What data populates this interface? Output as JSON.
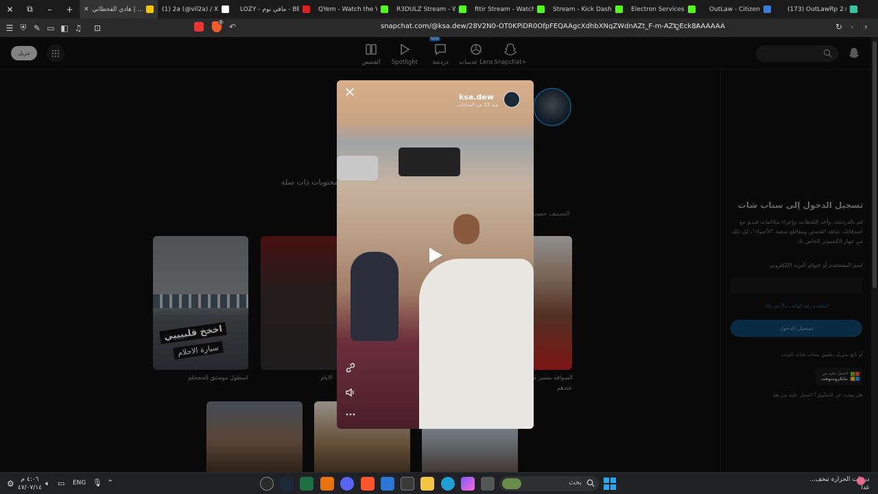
{
  "browser": {
    "tabs": [
      {
        "title": "هادي القحطاني | ...",
        "fav_color": "#f5c400",
        "active": true
      },
      {
        "title": "(1) 2a (@vil2a) / X",
        "fav_color": "#ffffff",
        "active": false
      },
      {
        "title": "LOZY - مافي نوم - BE...",
        "fav_color": "#e02020",
        "active": false
      },
      {
        "title": "QYem - Watch the VOD",
        "fav_color": "#53fc18",
        "active": false
      },
      {
        "title": "R3DULZ Stream - Watc...",
        "fav_color": "#53fc18",
        "active": false
      },
      {
        "title": "fttir Stream - Watch Li...",
        "fav_color": "#53fc18",
        "active": false
      },
      {
        "title": "Stream - Kick Dash...",
        "fav_color": "#53fc18",
        "active": false
      },
      {
        "title": "Electron Services",
        "fav_color": "#53fc18",
        "active": false
      },
      {
        "title": "OutLaw - Citizen",
        "fav_color": "#3a7bd5",
        "active": false
      },
      {
        "title": "(173) OutLawRp 2.0 - L...",
        "fav_color": "#37c4a0",
        "active": false
      }
    ],
    "url": "snapchat.com/@ksa.dew/28V2N0-OT0KPiDR0OfpFEQAAgcXdhbXNqZWdnAZt_F-m-AZt_Eck8AAAAAA",
    "shield_badge": "2"
  },
  "snap_nav": {
    "items": [
      {
        "label": "القصص",
        "icon": "stories-icon"
      },
      {
        "label": "Spotlight",
        "icon": "spotlight-play-icon"
      },
      {
        "label": "دردشة",
        "icon": "chat-icon",
        "badge": "NEW"
      },
      {
        "label": "عدسات Lens",
        "icon": "lens-icon"
      },
      {
        "label": "Snapchat+",
        "icon": "snapchat-plus-icon"
      }
    ],
    "download_label": "تنزيل"
  },
  "login": {
    "title": "تسجيل الدخول إلى سناب شات",
    "description": "قم بالدردشة، وأخذ اللقطات، وإجراء مكالمات فيديو مع أصدقائك، شاهد القصص ومقاطع منصة \"الأضواء\"، كل ذلك من جهاز الكمبيوتر الخاص بك.",
    "username_label": "اسم المستخدم أو عنوان البريد الإلكتروني",
    "phone_link": "استخدم رقم الهاتف بدلاً من ذلك",
    "login_button": "تسجيل الدخول",
    "or_text": "أو تابع بتنزيل تطبيق سناب شات الويب",
    "ms_store_line1": "احصل عليه من",
    "ms_store_line2": "مايكروسوفت",
    "help_text": "هل تبحث عن التطبيق؟ احصل عليه من هنا"
  },
  "content": {
    "related_label": "محتويات ذات صلة",
    "sort_label": "التصنيف حسب",
    "cards": [
      {
        "caption": "اسطول مومنتق الحجحلم",
        "overlay_line1": "اخخخ قلبيييي",
        "overlay_line2": "سيارة الاحلام"
      },
      {
        "caption": "الايام"
      },
      {
        "caption": "السواقه بمسر م...",
        "caption2": "عندهم"
      }
    ]
  },
  "modal": {
    "author_name": "ksa.dew",
    "author_sub": "منذ 22 من الساعات"
  },
  "taskbar": {
    "search_label": "بحث",
    "lang": "ENG",
    "clock_time": "٤:٠٦ م",
    "clock_date": "٤٧/٠٧/١٤",
    "weather_line1": "درجات الحرارة تنخف...",
    "weather_line2": "غداً"
  }
}
